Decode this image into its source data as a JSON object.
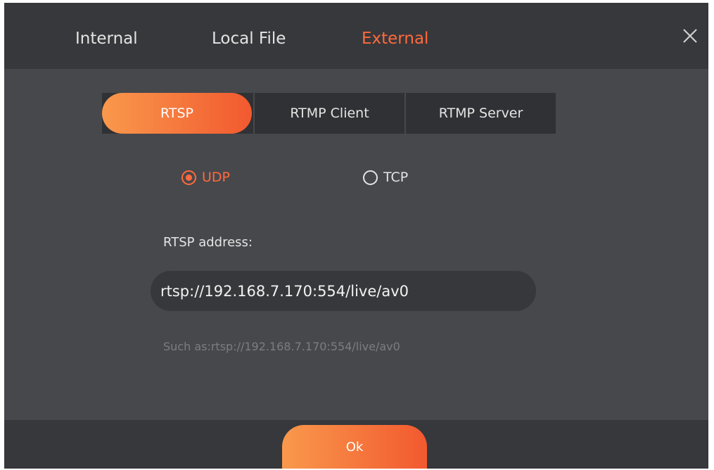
{
  "tabs": [
    {
      "label": "Internal",
      "active": false
    },
    {
      "label": "Local File",
      "active": false
    },
    {
      "label": "External",
      "active": true
    }
  ],
  "protocols": [
    {
      "label": "RTSP",
      "selected": true
    },
    {
      "label": "RTMP Client",
      "selected": false
    },
    {
      "label": "RTMP Server",
      "selected": false
    }
  ],
  "transport": [
    {
      "label": "UDP",
      "checked": true
    },
    {
      "label": "TCP",
      "checked": false
    }
  ],
  "address": {
    "label": "RTSP address:",
    "value": "rtsp://192.168.7.170:554/live/av0",
    "hint": "Such as:rtsp://192.168.7.170:554/live/av0"
  },
  "ok_label": "Ok",
  "icons": {
    "close": "close-icon"
  },
  "colors": {
    "accent": "#ff6a3d",
    "gradient_start": "#f9994c",
    "gradient_end": "#f2592f",
    "background": "#47484c",
    "header": "#37383b"
  }
}
